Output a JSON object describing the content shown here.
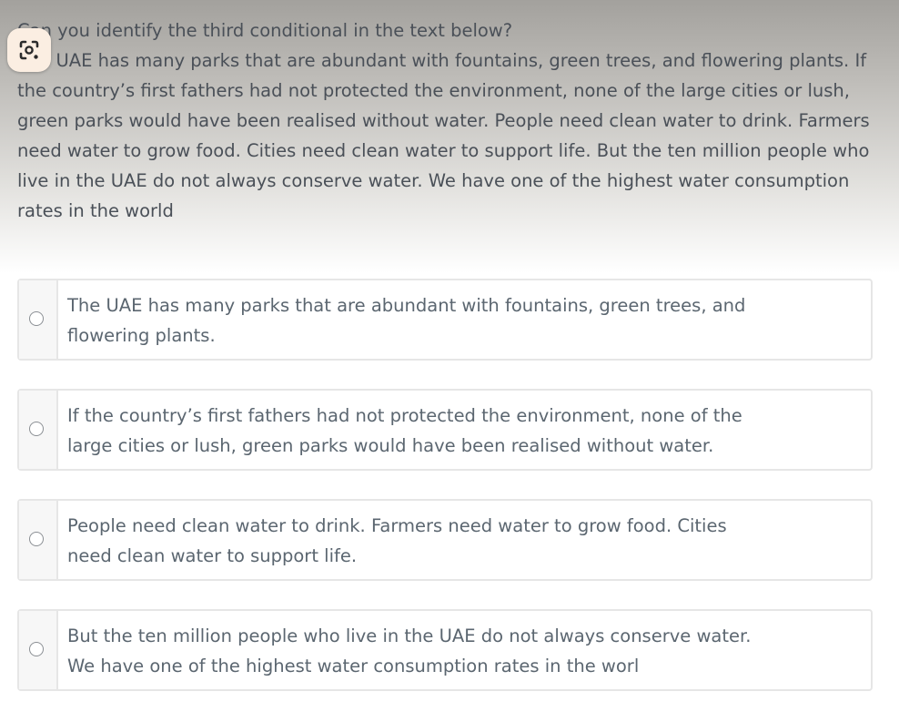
{
  "question": {
    "title": "Can you identify the third conditional in the text below?",
    "passage": "The UAE has many parks that are abundant with fountains, green trees, and flowering plants. If the country’s first fathers had not protected the environment, none of the large cities or lush, green parks would have been realised without water. People need clean water to drink. Farmers need water to grow food. Cities need clean water to support life. But the ten million people who live in the UAE do not always conserve water. We have one of the highest water consumption rates in the world"
  },
  "overlay": {
    "icon": "lens-camera-icon"
  },
  "options": [
    {
      "text": "The UAE has many parks that are abundant with fountains, green trees, and flowering plants."
    },
    {
      "text": "If the country’s first fathers had not protected the environment, none of the large cities or lush, green parks would have been realised without water."
    },
    {
      "text": "People need clean water to drink. Farmers need water to grow food. Cities need clean water to support life."
    },
    {
      "text": "But the ten million people who live in the UAE do not always conserve water. We have one of the highest water consumption rates in the worl"
    }
  ],
  "colors": {
    "text": "#5b6670",
    "border": "#e6e6e6",
    "lens_button_bg": "#fbeee2"
  }
}
